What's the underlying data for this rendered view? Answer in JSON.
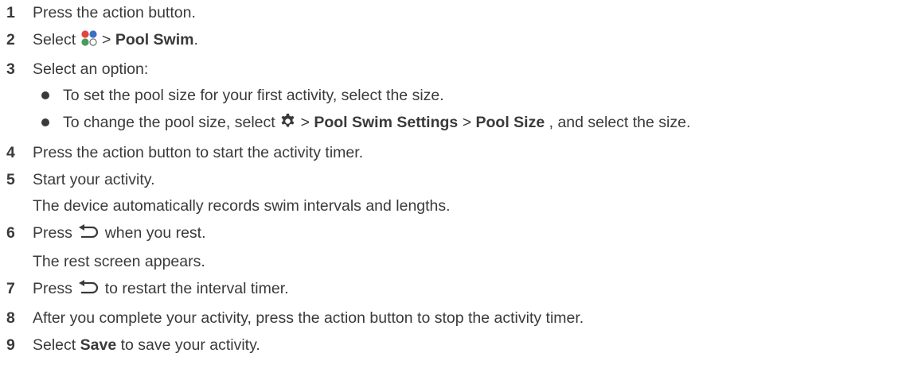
{
  "steps": [
    {
      "num": "1",
      "text": "Press the action button."
    },
    {
      "num": "2",
      "pre": "Select",
      "sep": ">",
      "bold": "Pool Swim",
      "post": "."
    },
    {
      "num": "3",
      "text": "Select an option:",
      "bullets": [
        {
          "text": "To set the pool size for your first activity, select the size."
        },
        {
          "pre": "To change the pool size, select",
          "sep1": ">",
          "bold1": "Pool Swim Settings",
          "sep2": ">",
          "bold2": "Pool Size",
          "post": ", and select the size."
        }
      ]
    },
    {
      "num": "4",
      "text": "Press the action button to start the activity timer."
    },
    {
      "num": "5",
      "text": "Start your activity.",
      "sub": "The device automatically records swim intervals and lengths."
    },
    {
      "num": "6",
      "pre": "Press",
      "post": "when you rest.",
      "sub": "The rest screen appears."
    },
    {
      "num": "7",
      "pre": "Press",
      "post": "to restart the interval timer."
    },
    {
      "num": "8",
      "text": "After you complete your activity, press the action button to stop the activity timer."
    },
    {
      "num": "9",
      "pre": "Select",
      "bold": "Save",
      "post": "to save your activity."
    }
  ],
  "icons": {
    "apps_icon_colors": [
      "#e0473f",
      "#3b6fc4",
      "#4d9a5a",
      "#ffffff"
    ],
    "gear_icon": "gear-icon",
    "back_icon": "back-icon"
  }
}
